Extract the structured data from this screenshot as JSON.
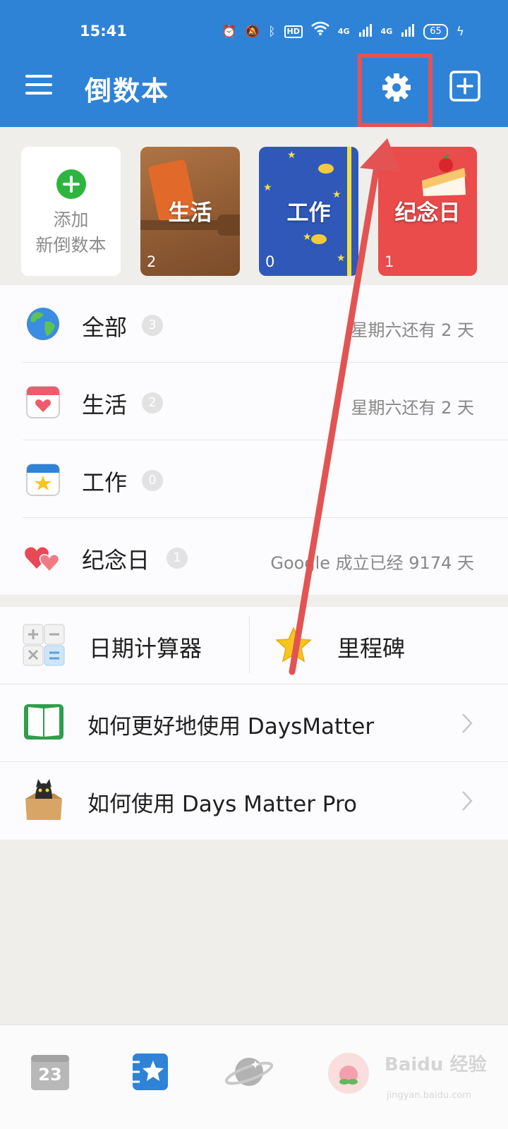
{
  "status_bar": {
    "time": "15:41",
    "battery": "65",
    "icons": [
      "alarm-icon",
      "mute-icon",
      "bluetooth-icon",
      "hd-icon",
      "wifi-icon",
      "signal-4g-icon",
      "signal-4g-icon",
      "battery-icon",
      "charging-icon"
    ],
    "hd_text": "HD",
    "net_text": "4G"
  },
  "header": {
    "title": "倒数本",
    "accent_color": "#2f83d6"
  },
  "books": {
    "add_label_1": "添加",
    "add_label_2": "新倒数本",
    "items": [
      {
        "title": "生活",
        "count": "2"
      },
      {
        "title": "工作",
        "count": "0"
      },
      {
        "title": "纪念日",
        "count": "1"
      }
    ]
  },
  "categories": [
    {
      "label": "全部",
      "badge": "3",
      "meta": "星期六还有 2 天",
      "icon": "globe-icon"
    },
    {
      "label": "生活",
      "badge": "2",
      "meta": "星期六还有 2 天",
      "icon": "heart-calendar-icon"
    },
    {
      "label": "工作",
      "badge": "0",
      "meta": "",
      "icon": "star-calendar-icon"
    },
    {
      "label": "纪念日",
      "badge": "1",
      "meta": "Google 成立已经 9174 天",
      "icon": "hearts-icon"
    }
  ],
  "tools": {
    "date_calc": "日期计算器",
    "milestone": "里程碑"
  },
  "links": [
    {
      "label": "如何更好地使用 DaysMatter",
      "icon": "book-icon"
    },
    {
      "label": "如何使用 Days Matter Pro",
      "icon": "cat-box-icon"
    }
  ],
  "tabbar": {
    "calendar_day": "23",
    "tabs": [
      "calendar-tab",
      "countdown-books-tab",
      "planet-tab",
      "peach-tab"
    ]
  },
  "watermark": {
    "text": "Baidu 经验",
    "url_text": "jingyan.baidu.com"
  },
  "annotation": {
    "highlight_color": "#e35353"
  }
}
